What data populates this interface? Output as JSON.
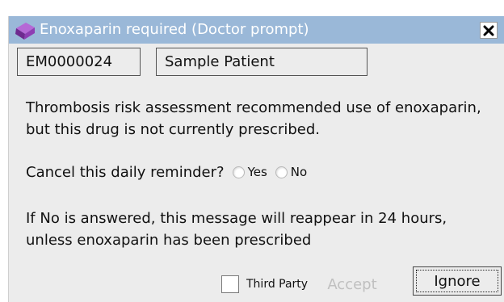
{
  "window": {
    "title": "Enoxaparin required (Doctor prompt)",
    "app_icon": "purple-gem-icon",
    "close_icon": "close-icon",
    "titlebar_color": "#9ab8d8"
  },
  "patient": {
    "id": "EM0000024",
    "name": "Sample Patient"
  },
  "message": {
    "line1": "Thrombosis risk assessment recommended use of enoxaparin,",
    "line2": "but this drug is not currently prescribed.",
    "question": "Cancel this daily reminder?",
    "options": [
      {
        "label": "Yes",
        "selected": false
      },
      {
        "label": "No",
        "selected": false
      }
    ],
    "note1": "If No is answered, this message will reappear in 24 hours,",
    "note2": "unless enoxaparin has been prescribed"
  },
  "footer": {
    "third_party_label": "Third Party",
    "third_party_checked": false,
    "accept_label": "Accept",
    "accept_enabled": false,
    "ignore_label": "Ignore"
  }
}
